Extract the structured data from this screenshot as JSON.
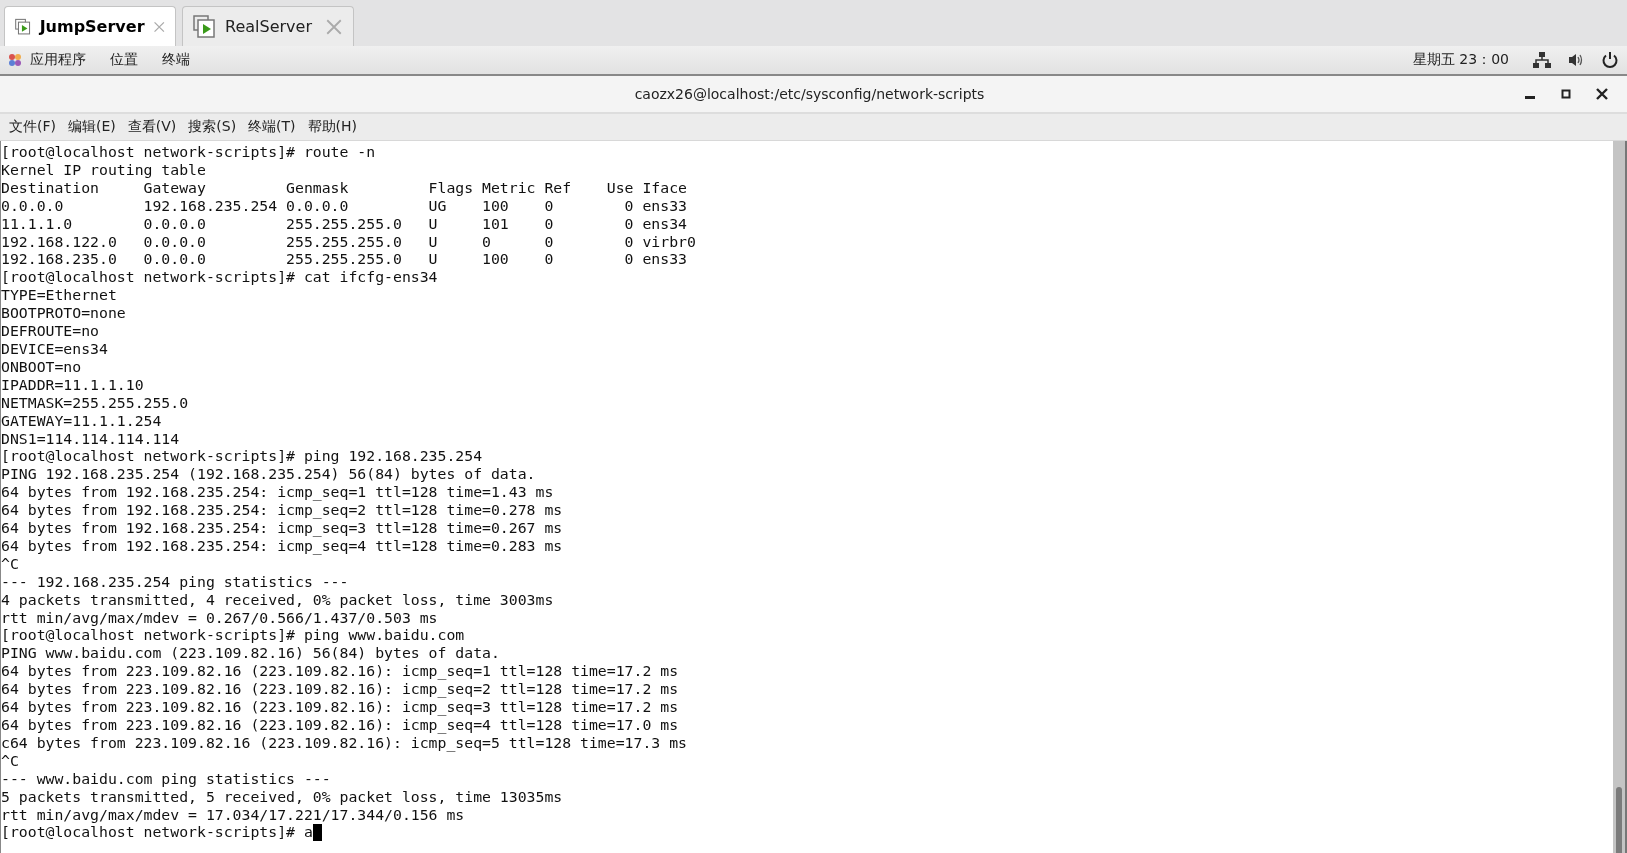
{
  "tabs": [
    {
      "label": "JumpServer",
      "selected": true
    },
    {
      "label": "RealServer",
      "selected": false
    }
  ],
  "panel": {
    "menus": [
      "应用程序",
      "位置",
      "终端"
    ],
    "clock": "星期五 23：00"
  },
  "window": {
    "title": "caozx26@localhost:/etc/sysconfig/network-scripts"
  },
  "menubar": [
    "文件(F)",
    "编辑(E)",
    "查看(V)",
    "搜索(S)",
    "终端(T)",
    "帮助(H)"
  ],
  "terminal": {
    "lines": [
      "[root@localhost network-scripts]# route -n",
      "Kernel IP routing table",
      "Destination     Gateway         Genmask         Flags Metric Ref    Use Iface",
      "0.0.0.0         192.168.235.254 0.0.0.0         UG    100    0        0 ens33",
      "11.1.1.0        0.0.0.0         255.255.255.0   U     101    0        0 ens34",
      "192.168.122.0   0.0.0.0         255.255.255.0   U     0      0        0 virbr0",
      "192.168.235.0   0.0.0.0         255.255.255.0   U     100    0        0 ens33",
      "[root@localhost network-scripts]# cat ifcfg-ens34",
      "TYPE=Ethernet",
      "BOOTPROTO=none",
      "DEFROUTE=no",
      "DEVICE=ens34",
      "ONBOOT=no",
      "IPADDR=11.1.1.10",
      "NETMASK=255.255.255.0",
      "GATEWAY=11.1.1.254",
      "DNS1=114.114.114.114",
      "[root@localhost network-scripts]# ping 192.168.235.254",
      "PING 192.168.235.254 (192.168.235.254) 56(84) bytes of data.",
      "64 bytes from 192.168.235.254: icmp_seq=1 ttl=128 time=1.43 ms",
      "64 bytes from 192.168.235.254: icmp_seq=2 ttl=128 time=0.278 ms",
      "64 bytes from 192.168.235.254: icmp_seq=3 ttl=128 time=0.267 ms",
      "64 bytes from 192.168.235.254: icmp_seq=4 ttl=128 time=0.283 ms",
      "^C",
      "--- 192.168.235.254 ping statistics ---",
      "4 packets transmitted, 4 received, 0% packet loss, time 3003ms",
      "rtt min/avg/max/mdev = 0.267/0.566/1.437/0.503 ms",
      "[root@localhost network-scripts]# ping www.baidu.com",
      "PING www.baidu.com (223.109.82.16) 56(84) bytes of data.",
      "64 bytes from 223.109.82.16 (223.109.82.16): icmp_seq=1 ttl=128 time=17.2 ms",
      "64 bytes from 223.109.82.16 (223.109.82.16): icmp_seq=2 ttl=128 time=17.2 ms",
      "64 bytes from 223.109.82.16 (223.109.82.16): icmp_seq=3 ttl=128 time=17.2 ms",
      "64 bytes from 223.109.82.16 (223.109.82.16): icmp_seq=4 ttl=128 time=17.0 ms",
      "c64 bytes from 223.109.82.16 (223.109.82.16): icmp_seq=5 ttl=128 time=17.3 ms",
      "^C",
      "--- www.baidu.com ping statistics ---",
      "5 packets transmitted, 5 received, 0% packet loss, time 13035ms",
      "rtt min/avg/max/mdev = 17.034/17.221/17.344/0.156 ms"
    ],
    "prompt": "[root@localhost network-scripts]# a"
  }
}
